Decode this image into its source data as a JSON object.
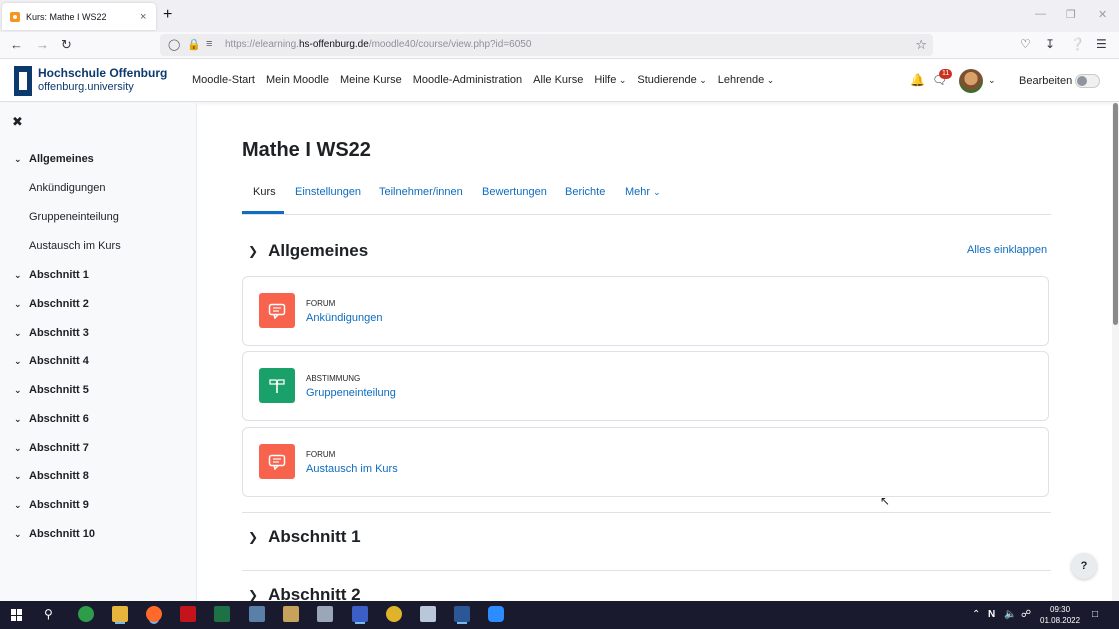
{
  "browser": {
    "tab_title": "Kurs: Mathe I WS22",
    "tab_close": "×",
    "new_tab": "+",
    "url_prefix": "https://elearning.",
    "url_host": "hs-offenburg.de",
    "url_path": "/moodle40/course/view.php?id=6050"
  },
  "moodle": {
    "logo_name": "Hochschule Offenburg",
    "logo_sub": "offenburg.university",
    "nav": [
      "Moodle-Start",
      "Mein Moodle",
      "Meine Kurse",
      "Moodle-Administration",
      "Alle Kurse",
      "Hilfe",
      "Studierende",
      "Lehrende"
    ],
    "message_count": "11",
    "edit_label": "Bearbeiten",
    "edit_mode_on": false
  },
  "drawer": {
    "close": "✖",
    "items": [
      {
        "label": "Allgemeines",
        "kind": "section"
      },
      {
        "label": "Ankündigungen",
        "kind": "sub"
      },
      {
        "label": "Gruppeneinteilung",
        "kind": "sub"
      },
      {
        "label": "Austausch im Kurs",
        "kind": "sub"
      },
      {
        "label": "Abschnitt 1",
        "kind": "section"
      },
      {
        "label": "Abschnitt 2",
        "kind": "section"
      },
      {
        "label": "Abschnitt 3",
        "kind": "section"
      },
      {
        "label": "Abschnitt 4",
        "kind": "section"
      },
      {
        "label": "Abschnitt 5",
        "kind": "section"
      },
      {
        "label": "Abschnitt 6",
        "kind": "section"
      },
      {
        "label": "Abschnitt 7",
        "kind": "section"
      },
      {
        "label": "Abschnitt 8",
        "kind": "section"
      },
      {
        "label": "Abschnitt 9",
        "kind": "section"
      },
      {
        "label": "Abschnitt 10",
        "kind": "section"
      }
    ]
  },
  "course": {
    "title": "Mathe I WS22",
    "tabs": [
      "Kurs",
      "Einstellungen",
      "Teilnehmer/innen",
      "Bewertungen",
      "Berichte",
      "Mehr"
    ],
    "collapse_all": "Alles einklappen",
    "sections": [
      "Allgemeines",
      "Abschnitt 1",
      "Abschnitt 2"
    ],
    "activities": [
      {
        "type": "FORUM",
        "name": "Ankündigungen"
      },
      {
        "type": "ABSTIMMUNG",
        "name": "Gruppeneinteilung"
      },
      {
        "type": "FORUM",
        "name": "Austausch im Kurs"
      }
    ]
  },
  "help_button": "?",
  "taskbar": {
    "time": "09:30",
    "date": "01.08.2022"
  }
}
